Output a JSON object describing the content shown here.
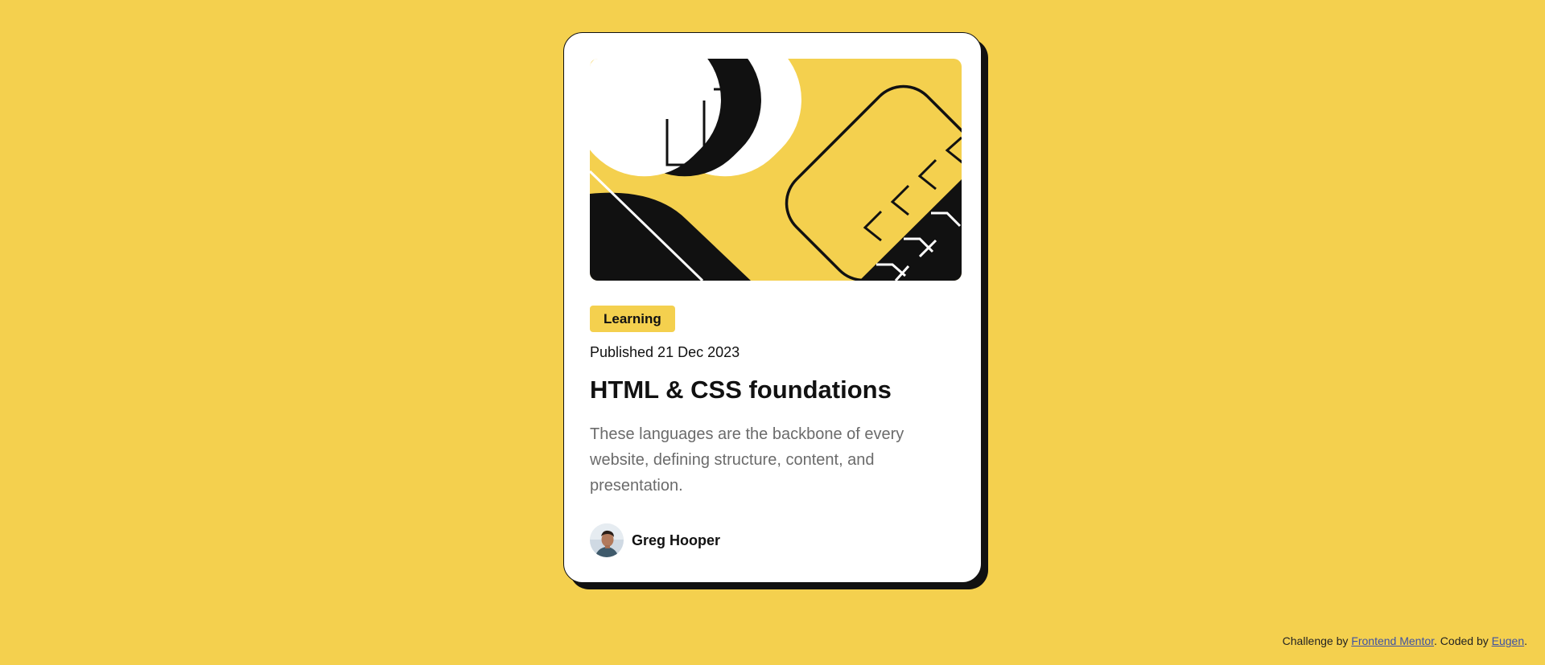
{
  "colors": {
    "background": "#F4D04E",
    "card": "#FFFFFF",
    "ink": "#111111",
    "muted_text": "#6B6B6B",
    "link": "#3E52A3"
  },
  "card": {
    "illustration_icon": "abstract-geometric-illustration",
    "tag": "Learning",
    "published": "Published 21 Dec 2023",
    "title": "HTML & CSS foundations",
    "description": "These languages are the backbone of every website, defining structure, content, and presentation.",
    "author": {
      "avatar_icon": "avatar-photo",
      "name": "Greg Hooper"
    }
  },
  "attribution": {
    "prefix": "Challenge by",
    "challenge_link": "Frontend Mentor",
    "middle": ". Coded by",
    "author_link": "Eugen",
    "suffix": "."
  }
}
